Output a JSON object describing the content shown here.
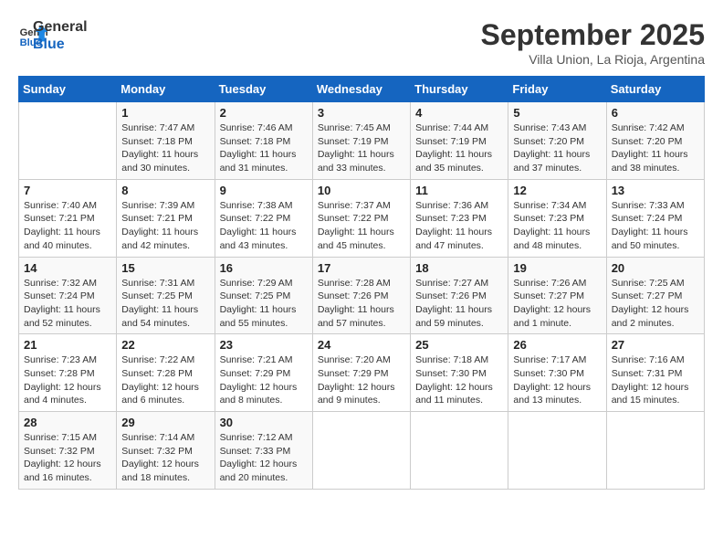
{
  "header": {
    "logo_line1": "General",
    "logo_line2": "Blue",
    "month": "September 2025",
    "location": "Villa Union, La Rioja, Argentina"
  },
  "weekdays": [
    "Sunday",
    "Monday",
    "Tuesday",
    "Wednesday",
    "Thursday",
    "Friday",
    "Saturday"
  ],
  "weeks": [
    [
      {
        "day": "",
        "sunrise": "",
        "sunset": "",
        "daylight": ""
      },
      {
        "day": "1",
        "sunrise": "Sunrise: 7:47 AM",
        "sunset": "Sunset: 7:18 PM",
        "daylight": "Daylight: 11 hours and 30 minutes."
      },
      {
        "day": "2",
        "sunrise": "Sunrise: 7:46 AM",
        "sunset": "Sunset: 7:18 PM",
        "daylight": "Daylight: 11 hours and 31 minutes."
      },
      {
        "day": "3",
        "sunrise": "Sunrise: 7:45 AM",
        "sunset": "Sunset: 7:19 PM",
        "daylight": "Daylight: 11 hours and 33 minutes."
      },
      {
        "day": "4",
        "sunrise": "Sunrise: 7:44 AM",
        "sunset": "Sunset: 7:19 PM",
        "daylight": "Daylight: 11 hours and 35 minutes."
      },
      {
        "day": "5",
        "sunrise": "Sunrise: 7:43 AM",
        "sunset": "Sunset: 7:20 PM",
        "daylight": "Daylight: 11 hours and 37 minutes."
      },
      {
        "day": "6",
        "sunrise": "Sunrise: 7:42 AM",
        "sunset": "Sunset: 7:20 PM",
        "daylight": "Daylight: 11 hours and 38 minutes."
      }
    ],
    [
      {
        "day": "7",
        "sunrise": "Sunrise: 7:40 AM",
        "sunset": "Sunset: 7:21 PM",
        "daylight": "Daylight: 11 hours and 40 minutes."
      },
      {
        "day": "8",
        "sunrise": "Sunrise: 7:39 AM",
        "sunset": "Sunset: 7:21 PM",
        "daylight": "Daylight: 11 hours and 42 minutes."
      },
      {
        "day": "9",
        "sunrise": "Sunrise: 7:38 AM",
        "sunset": "Sunset: 7:22 PM",
        "daylight": "Daylight: 11 hours and 43 minutes."
      },
      {
        "day": "10",
        "sunrise": "Sunrise: 7:37 AM",
        "sunset": "Sunset: 7:22 PM",
        "daylight": "Daylight: 11 hours and 45 minutes."
      },
      {
        "day": "11",
        "sunrise": "Sunrise: 7:36 AM",
        "sunset": "Sunset: 7:23 PM",
        "daylight": "Daylight: 11 hours and 47 minutes."
      },
      {
        "day": "12",
        "sunrise": "Sunrise: 7:34 AM",
        "sunset": "Sunset: 7:23 PM",
        "daylight": "Daylight: 11 hours and 48 minutes."
      },
      {
        "day": "13",
        "sunrise": "Sunrise: 7:33 AM",
        "sunset": "Sunset: 7:24 PM",
        "daylight": "Daylight: 11 hours and 50 minutes."
      }
    ],
    [
      {
        "day": "14",
        "sunrise": "Sunrise: 7:32 AM",
        "sunset": "Sunset: 7:24 PM",
        "daylight": "Daylight: 11 hours and 52 minutes."
      },
      {
        "day": "15",
        "sunrise": "Sunrise: 7:31 AM",
        "sunset": "Sunset: 7:25 PM",
        "daylight": "Daylight: 11 hours and 54 minutes."
      },
      {
        "day": "16",
        "sunrise": "Sunrise: 7:29 AM",
        "sunset": "Sunset: 7:25 PM",
        "daylight": "Daylight: 11 hours and 55 minutes."
      },
      {
        "day": "17",
        "sunrise": "Sunrise: 7:28 AM",
        "sunset": "Sunset: 7:26 PM",
        "daylight": "Daylight: 11 hours and 57 minutes."
      },
      {
        "day": "18",
        "sunrise": "Sunrise: 7:27 AM",
        "sunset": "Sunset: 7:26 PM",
        "daylight": "Daylight: 11 hours and 59 minutes."
      },
      {
        "day": "19",
        "sunrise": "Sunrise: 7:26 AM",
        "sunset": "Sunset: 7:27 PM",
        "daylight": "Daylight: 12 hours and 1 minute."
      },
      {
        "day": "20",
        "sunrise": "Sunrise: 7:25 AM",
        "sunset": "Sunset: 7:27 PM",
        "daylight": "Daylight: 12 hours and 2 minutes."
      }
    ],
    [
      {
        "day": "21",
        "sunrise": "Sunrise: 7:23 AM",
        "sunset": "Sunset: 7:28 PM",
        "daylight": "Daylight: 12 hours and 4 minutes."
      },
      {
        "day": "22",
        "sunrise": "Sunrise: 7:22 AM",
        "sunset": "Sunset: 7:28 PM",
        "daylight": "Daylight: 12 hours and 6 minutes."
      },
      {
        "day": "23",
        "sunrise": "Sunrise: 7:21 AM",
        "sunset": "Sunset: 7:29 PM",
        "daylight": "Daylight: 12 hours and 8 minutes."
      },
      {
        "day": "24",
        "sunrise": "Sunrise: 7:20 AM",
        "sunset": "Sunset: 7:29 PM",
        "daylight": "Daylight: 12 hours and 9 minutes."
      },
      {
        "day": "25",
        "sunrise": "Sunrise: 7:18 AM",
        "sunset": "Sunset: 7:30 PM",
        "daylight": "Daylight: 12 hours and 11 minutes."
      },
      {
        "day": "26",
        "sunrise": "Sunrise: 7:17 AM",
        "sunset": "Sunset: 7:30 PM",
        "daylight": "Daylight: 12 hours and 13 minutes."
      },
      {
        "day": "27",
        "sunrise": "Sunrise: 7:16 AM",
        "sunset": "Sunset: 7:31 PM",
        "daylight": "Daylight: 12 hours and 15 minutes."
      }
    ],
    [
      {
        "day": "28",
        "sunrise": "Sunrise: 7:15 AM",
        "sunset": "Sunset: 7:32 PM",
        "daylight": "Daylight: 12 hours and 16 minutes."
      },
      {
        "day": "29",
        "sunrise": "Sunrise: 7:14 AM",
        "sunset": "Sunset: 7:32 PM",
        "daylight": "Daylight: 12 hours and 18 minutes."
      },
      {
        "day": "30",
        "sunrise": "Sunrise: 7:12 AM",
        "sunset": "Sunset: 7:33 PM",
        "daylight": "Daylight: 12 hours and 20 minutes."
      },
      {
        "day": "",
        "sunrise": "",
        "sunset": "",
        "daylight": ""
      },
      {
        "day": "",
        "sunrise": "",
        "sunset": "",
        "daylight": ""
      },
      {
        "day": "",
        "sunrise": "",
        "sunset": "",
        "daylight": ""
      },
      {
        "day": "",
        "sunrise": "",
        "sunset": "",
        "daylight": ""
      }
    ]
  ]
}
